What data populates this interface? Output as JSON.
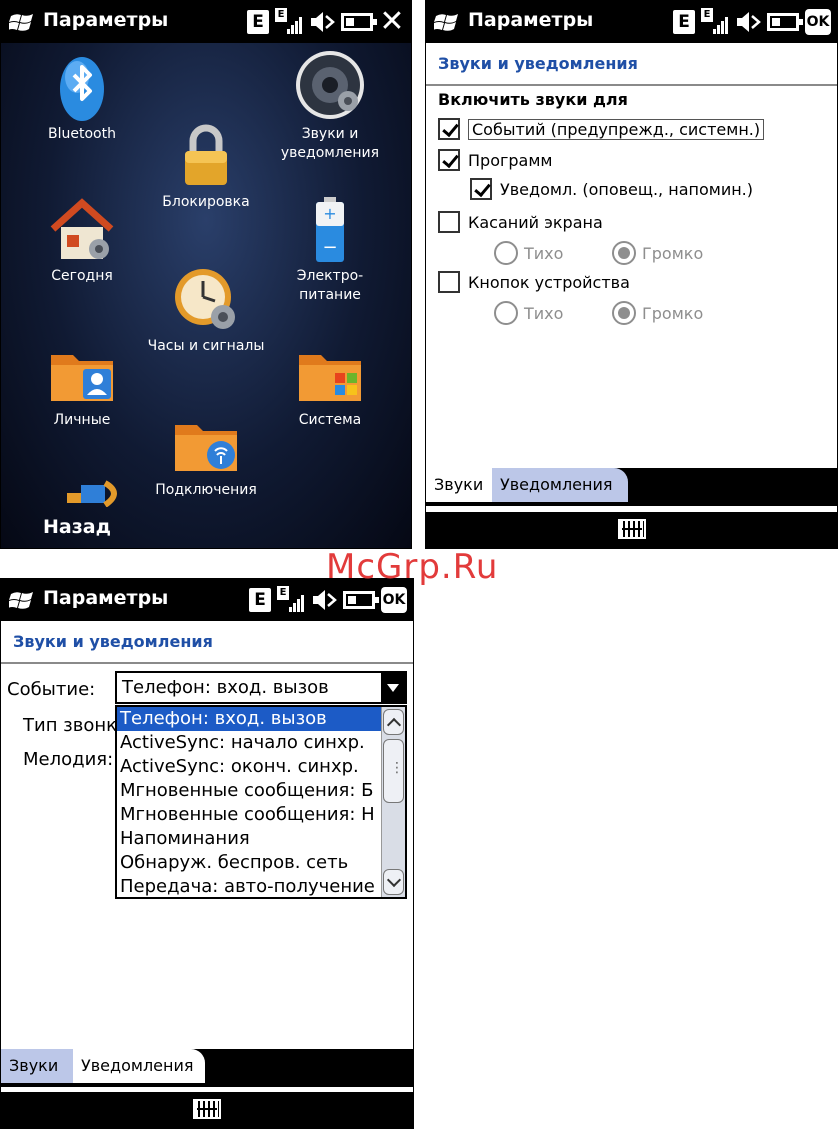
{
  "status": {
    "title": "Параметры",
    "e_badge": "E",
    "close_glyph": "✕",
    "ok_label": "OK"
  },
  "settings": {
    "items": [
      {
        "label": "Bluetooth",
        "icon": "bluetooth-icon"
      },
      {
        "label": "Звуки и\nуведомления",
        "icon": "speaker-icon"
      },
      {
        "label": "Блокировка",
        "icon": "lock-icon"
      },
      {
        "label": "Сегодня",
        "icon": "home-icon"
      },
      {
        "label": "Электро-\nпитание",
        "icon": "battery-icon"
      },
      {
        "label": "Часы и сигналы",
        "icon": "clock-icon"
      },
      {
        "label": "Личные",
        "icon": "personal-folder-icon"
      },
      {
        "label": "Система",
        "icon": "system-folder-icon"
      },
      {
        "label": "Подключения",
        "icon": "connections-folder-icon"
      }
    ],
    "back_label": "Назад"
  },
  "sounds": {
    "section_title": "Звуки и уведомления",
    "heading": "Включить звуки для",
    "events": "Событий (предупрежд., системн.)",
    "programs": "Программ",
    "notifications": "Уведомл. (оповещ., напомин.)",
    "screen_taps": "Касаний экрана",
    "device_buttons": "Кнопок устройства",
    "quiet": "Тихо",
    "loud": "Громко",
    "tab_sounds": "Звуки",
    "tab_notifications": "Уведомления"
  },
  "notifications": {
    "section_title": "Звуки и уведомления",
    "event_label": "Событие:",
    "ring_type_label": "Тип звонка",
    "melody_label": "Мелодия:",
    "selected_event": "Телефон: вход. вызов",
    "options": [
      "Телефон: вход. вызов",
      "ActiveSync: начало синхр.",
      "ActiveSync: оконч. синхр.",
      "Мгновенные сообщения: Б",
      "Мгновенные сообщения: Н",
      "Напоминания",
      "Обнаруж. беспров. сеть",
      "Передача: авто-получение"
    ],
    "tab_sounds": "Звуки",
    "tab_notifications": "Уведомления"
  },
  "watermark": "McGrp.Ru",
  "colors": {
    "title_blue": "#1f4fa6",
    "selection_blue": "#1c5bc6",
    "tab_inactive": "#bcc7e8",
    "watermark_red": "#e23b3b"
  }
}
